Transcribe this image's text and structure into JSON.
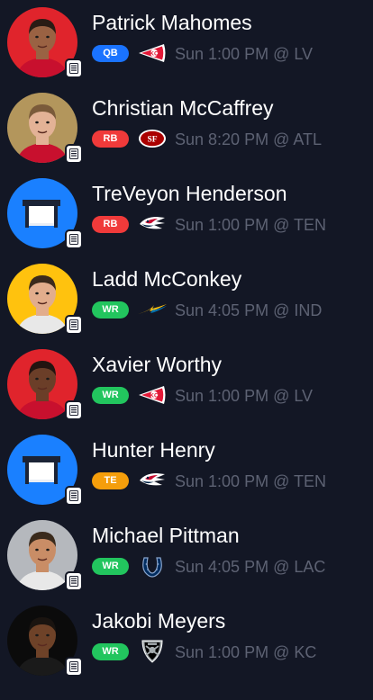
{
  "players": [
    {
      "name": "Patrick Mahomes",
      "position": "QB",
      "position_color": "#1a73ff",
      "team": "KC",
      "team_logo_icon": "chiefs-arrowhead-icon",
      "game": "Sun 1:00 PM @ LV",
      "avatar_type": "photo",
      "avatar_bg": "#e0242c",
      "skin": "#9a6243",
      "hair": "#2a1b14",
      "jersey": "#c8102e"
    },
    {
      "name": "Christian McCaffrey",
      "position": "RB",
      "position_color": "#f03a3a",
      "team": "SF",
      "team_logo_icon": "49ers-sf-oval-icon",
      "game": "Sun 8:20 PM @ ATL",
      "avatar_type": "photo",
      "avatar_bg": "#b3965c",
      "skin": "#e3b296",
      "hair": "#7a5a3a",
      "jersey": "#c8102e"
    },
    {
      "name": "TreVeyon Henderson",
      "position": "RB",
      "position_color": "#f03a3a",
      "team": "NE",
      "team_logo_icon": "patriots-flying-elvis-icon",
      "game": "Sun 1:00 PM @ TEN",
      "avatar_type": "placeholder",
      "avatar_bg": "#1a80ff"
    },
    {
      "name": "Ladd McConkey",
      "position": "WR",
      "position_color": "#22c55e",
      "team": "LAC",
      "team_logo_icon": "chargers-bolt-icon",
      "game": "Sun 4:05 PM @ IND",
      "avatar_type": "photo",
      "avatar_bg": "#ffc20e",
      "skin": "#e2ad8c",
      "hair": "#3b2a1c",
      "jersey": "#e8e8e8"
    },
    {
      "name": "Xavier Worthy",
      "position": "WR",
      "position_color": "#22c55e",
      "team": "KC",
      "team_logo_icon": "chiefs-arrowhead-icon",
      "game": "Sun 1:00 PM @ LV",
      "avatar_type": "photo",
      "avatar_bg": "#e0242c",
      "skin": "#6b3e28",
      "hair": "#231410",
      "jersey": "#c8102e"
    },
    {
      "name": "Hunter Henry",
      "position": "TE",
      "position_color": "#f59e0b",
      "team": "NE",
      "team_logo_icon": "patriots-flying-elvis-icon",
      "game": "Sun 1:00 PM @ TEN",
      "avatar_type": "placeholder",
      "avatar_bg": "#1a80ff"
    },
    {
      "name": "Michael Pittman",
      "position": "WR",
      "position_color": "#22c55e",
      "team": "IND",
      "team_logo_icon": "colts-horseshoe-icon",
      "game": "Sun 4:05 PM @ LAC",
      "avatar_type": "photo",
      "avatar_bg": "#b5b8bd",
      "skin": "#c98d66",
      "hair": "#3a2a1c",
      "jersey": "#e8e8e8"
    },
    {
      "name": "Jakobi Meyers",
      "position": "WR",
      "position_color": "#22c55e",
      "team": "LV",
      "team_logo_icon": "raiders-shield-icon",
      "game": "Sun 1:00 PM @ KC",
      "avatar_type": "photo",
      "avatar_bg": "#0b0b0b",
      "skin": "#6e4228",
      "hair": "#1a1410",
      "jersey": "#1a1a1a"
    }
  ]
}
